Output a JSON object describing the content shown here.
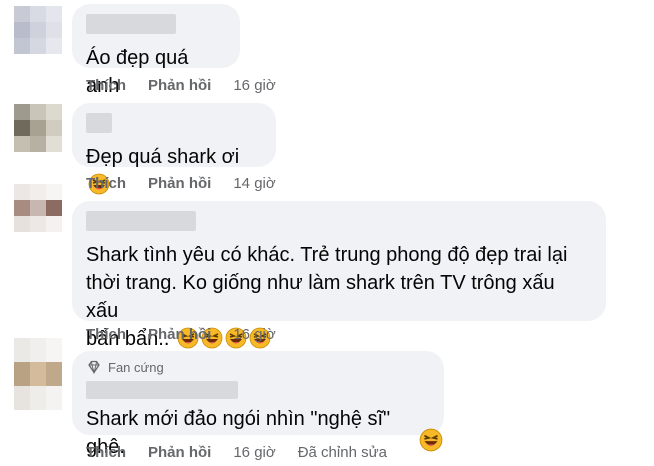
{
  "comments": [
    {
      "text": "Áo đẹp quá anh",
      "emoji_count": 0,
      "like_label": "Thích",
      "reply_label": "Phản hồi",
      "time": "16 giờ"
    },
    {
      "text": "Đẹp quá shark ơi",
      "emoji_count": 1,
      "like_label": "Thích",
      "reply_label": "Phản hồi",
      "time": "14 giờ"
    },
    {
      "text_line1": "Shark tình yêu có khác. Trẻ trung phong độ đẹp trai lại",
      "text_line2": "thời trang. Ko giống như làm shark trên TV trông xấu xấu",
      "text_line3": "bẩn bẩn..",
      "emoji_count": 4,
      "like_label": "Thích",
      "reply_label": "Phản hồi",
      "time": "16 giờ"
    },
    {
      "badge": "Fan cứng",
      "text": "Shark mới đảo ngói nhìn \"nghệ sĩ\" ghê.",
      "emoji_count": 1,
      "like_label": "Thích",
      "reply_label": "Phản hồi",
      "time": "16 giờ",
      "edited": "Đã chỉnh sửa"
    }
  ],
  "colors": {
    "bubble": "#f0f2f5",
    "meta_text": "#65676b",
    "body_text": "#050505"
  },
  "emoji_icon": "laughing-face-icon"
}
